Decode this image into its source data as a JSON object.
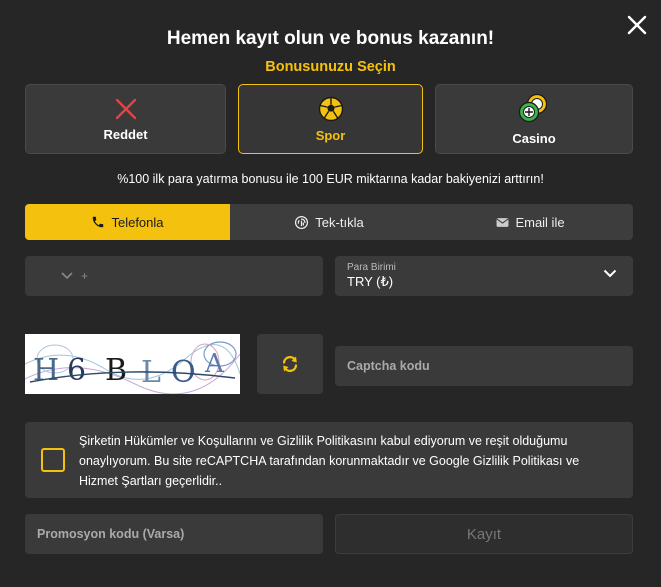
{
  "header": {
    "title": "Hemen kayıt olun ve bonus kazanın!",
    "subtitle": "Bonusunuzu Seçin"
  },
  "bonus_options": [
    {
      "label": "Reddet",
      "icon": "x-icon",
      "selected": false
    },
    {
      "label": "Spor",
      "icon": "soccer-ball-icon",
      "selected": true
    },
    {
      "label": "Casino",
      "icon": "casino-chips-icon",
      "selected": false
    }
  ],
  "bonus_description": "%100 ilk para yatırma bonusu ile 100 EUR miktarına kadar bakiyenizi arttırın!",
  "tabs": [
    {
      "label": "Telefonla",
      "icon": "phone-icon",
      "active": true
    },
    {
      "label": "Tek-tıkla",
      "icon": "fingerprint-icon",
      "active": false
    },
    {
      "label": "Email ile",
      "icon": "envelope-icon",
      "active": false
    }
  ],
  "phone": {
    "prefix": "+"
  },
  "currency": {
    "label": "Para Birimi",
    "value": "TRY (₺)"
  },
  "captcha": {
    "image_text": "H6BLOA",
    "input_placeholder": "Captcha kodu"
  },
  "terms": {
    "text": "Şirketin Hükümler ve Koşullarını ve Gizlilik Politikasını kabul ediyorum ve reşit olduğumu onaylıyorum. Bu site reCAPTCHA tarafından korunmaktadır ve Google Gizlilik Politikası ve Hizmet Şartları geçerlidir.."
  },
  "promo": {
    "placeholder": "Promosyon kodu (Varsa)"
  },
  "submit_label": "Kayıt",
  "colors": {
    "accent": "#f5c10f",
    "danger": "#e04444",
    "background": "#262626",
    "field": "#3a3a3a"
  }
}
